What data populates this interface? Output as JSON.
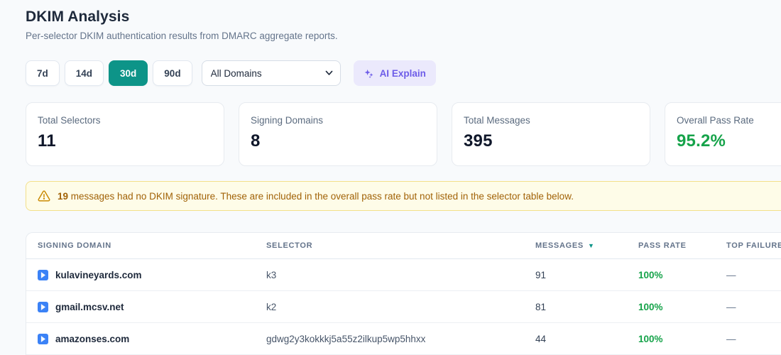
{
  "header": {
    "title": "DKIM Analysis",
    "subtitle": "Per-selector DKIM authentication results from DMARC aggregate reports."
  },
  "filters": {
    "ranges": [
      {
        "label": "7d",
        "active": false
      },
      {
        "label": "14d",
        "active": false
      },
      {
        "label": "30d",
        "active": true
      },
      {
        "label": "90d",
        "active": false
      }
    ],
    "domain_select": {
      "value": "All Domains"
    },
    "ai_explain_label": "AI Explain"
  },
  "stats": [
    {
      "label": "Total Selectors",
      "value": "11"
    },
    {
      "label": "Signing Domains",
      "value": "8"
    },
    {
      "label": "Total Messages",
      "value": "395"
    },
    {
      "label": "Overall Pass Rate",
      "value": "95.2%"
    }
  ],
  "warning": {
    "count": "19",
    "text": " messages had no DKIM signature. These are included in the overall pass rate but not listed in the selector table below."
  },
  "table": {
    "columns": [
      "SIGNING DOMAIN",
      "SELECTOR",
      "MESSAGES",
      "PASS RATE",
      "TOP FAILURE"
    ],
    "sort_indicator": "▼",
    "sorted_column": "MESSAGES",
    "rows": [
      {
        "domain": "kulavineyards.com",
        "selector": "k3",
        "messages": "91",
        "pass_rate": "100%",
        "top_failure": "—"
      },
      {
        "domain": "gmail.mcsv.net",
        "selector": "k2",
        "messages": "81",
        "pass_rate": "100%",
        "top_failure": "—"
      },
      {
        "domain": "amazonses.com",
        "selector": "gdwg2y3kokkkj5a55z2ilkup5wp5hhxx",
        "messages": "44",
        "pass_rate": "100%",
        "top_failure": "—"
      }
    ]
  },
  "colors": {
    "accent_teal": "#0d9488",
    "pass_green": "#16a34a",
    "warning_text": "#a16207",
    "warning_bg": "#fefce8",
    "ai_purple": "#6d5ce8",
    "expand_icon_blue": "#3b82f6"
  }
}
